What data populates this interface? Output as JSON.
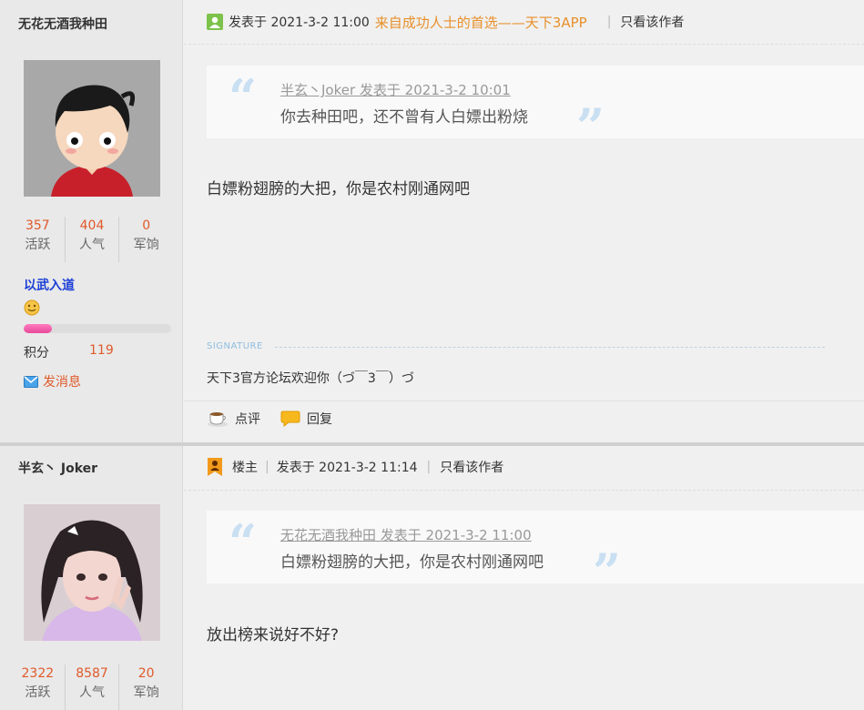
{
  "post1": {
    "author": {
      "name": "无花无酒我种田",
      "stats": [
        {
          "value": "357",
          "label": "活跃"
        },
        {
          "value": "404",
          "label": "人气"
        },
        {
          "value": "0",
          "label": "军饷"
        }
      ],
      "rank": "以武入道",
      "exp_fraction": 0.19,
      "points_label": "积分",
      "points_value": "119",
      "message_label": "发消息"
    },
    "header": {
      "posted": "发表于 2021-3-2 11:00",
      "promo": "来自成功人士的首选——天下3APP",
      "only_author": "只看该作者"
    },
    "quote": {
      "head": "半玄丶Joker 发表于 2021-3-2 10:01",
      "text": "你去种田吧，还不曾有人白嫖出粉烧"
    },
    "content": "白嫖粉翅膀的大把，你是农村刚通网吧",
    "signature": {
      "label": "SIGNATURE",
      "text": "天下3官方论坛欢迎你（づ￣3￣）づ"
    },
    "actions": {
      "comment": "点评",
      "reply": "回复"
    }
  },
  "post2": {
    "author": {
      "name": "半玄丶 Joker",
      "stats": [
        {
          "value": "2322",
          "label": "活跃"
        },
        {
          "value": "8587",
          "label": "人气"
        },
        {
          "value": "20",
          "label": "军饷"
        }
      ]
    },
    "header": {
      "owner": "楼主",
      "posted": "发表于 2021-3-2 11:14",
      "only_author": "只看该作者"
    },
    "quote": {
      "head": "无花无酒我种田 发表于 2021-3-2 11:00",
      "text": "白嫖粉翅膀的大把，你是农村刚通网吧"
    },
    "content": "放出榜来说好不好?"
  },
  "colors": {
    "stat_number": "#e05a2b",
    "rank": "#1b3fd6",
    "promo": "#e8902a",
    "quote_mark": "#c9dff2"
  }
}
